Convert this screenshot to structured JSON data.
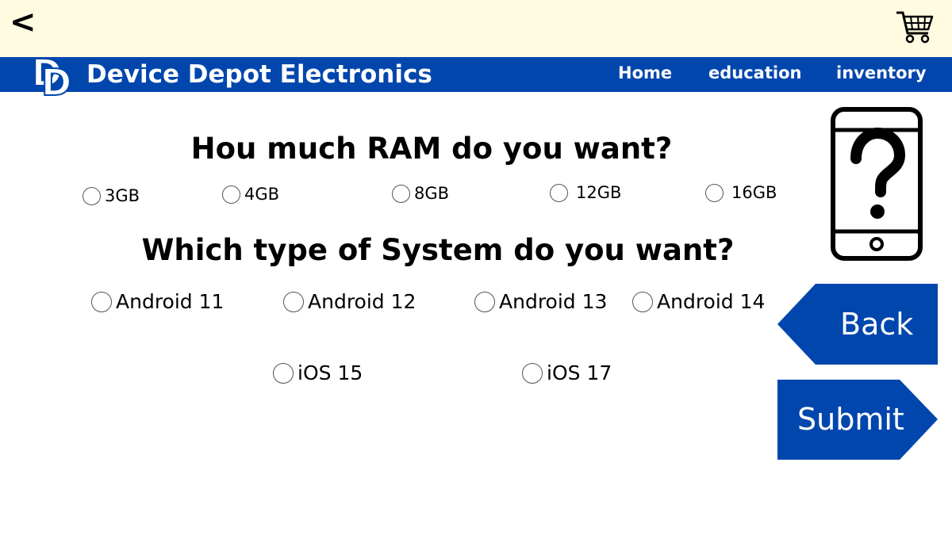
{
  "header": {
    "back_symbol": "<",
    "back_icon": "back-chevron-icon",
    "cart_icon": "cart-icon",
    "brand": "Device Depot Electronics",
    "logo_text": "DD",
    "nav": [
      {
        "label": "Home"
      },
      {
        "label": "education"
      },
      {
        "label": "inventory"
      }
    ],
    "bar_color": "#0046ad",
    "top_color": "#fefbe0"
  },
  "form": {
    "ram_question": "Hou much RAM do you want?",
    "ram_options": [
      "3GB",
      "4GB",
      "8GB",
      "12GB",
      "16GB"
    ],
    "system_question": "Which  type of System do you want?",
    "system_options": [
      "Android 11",
      "Android 12",
      "Android 13",
      "Android 14",
      "iOS 15",
      "iOS 17"
    ]
  },
  "side": {
    "help_icon": "phone-question-icon",
    "back_label": "Back",
    "submit_label": "Submit",
    "button_color": "#0046ad"
  }
}
